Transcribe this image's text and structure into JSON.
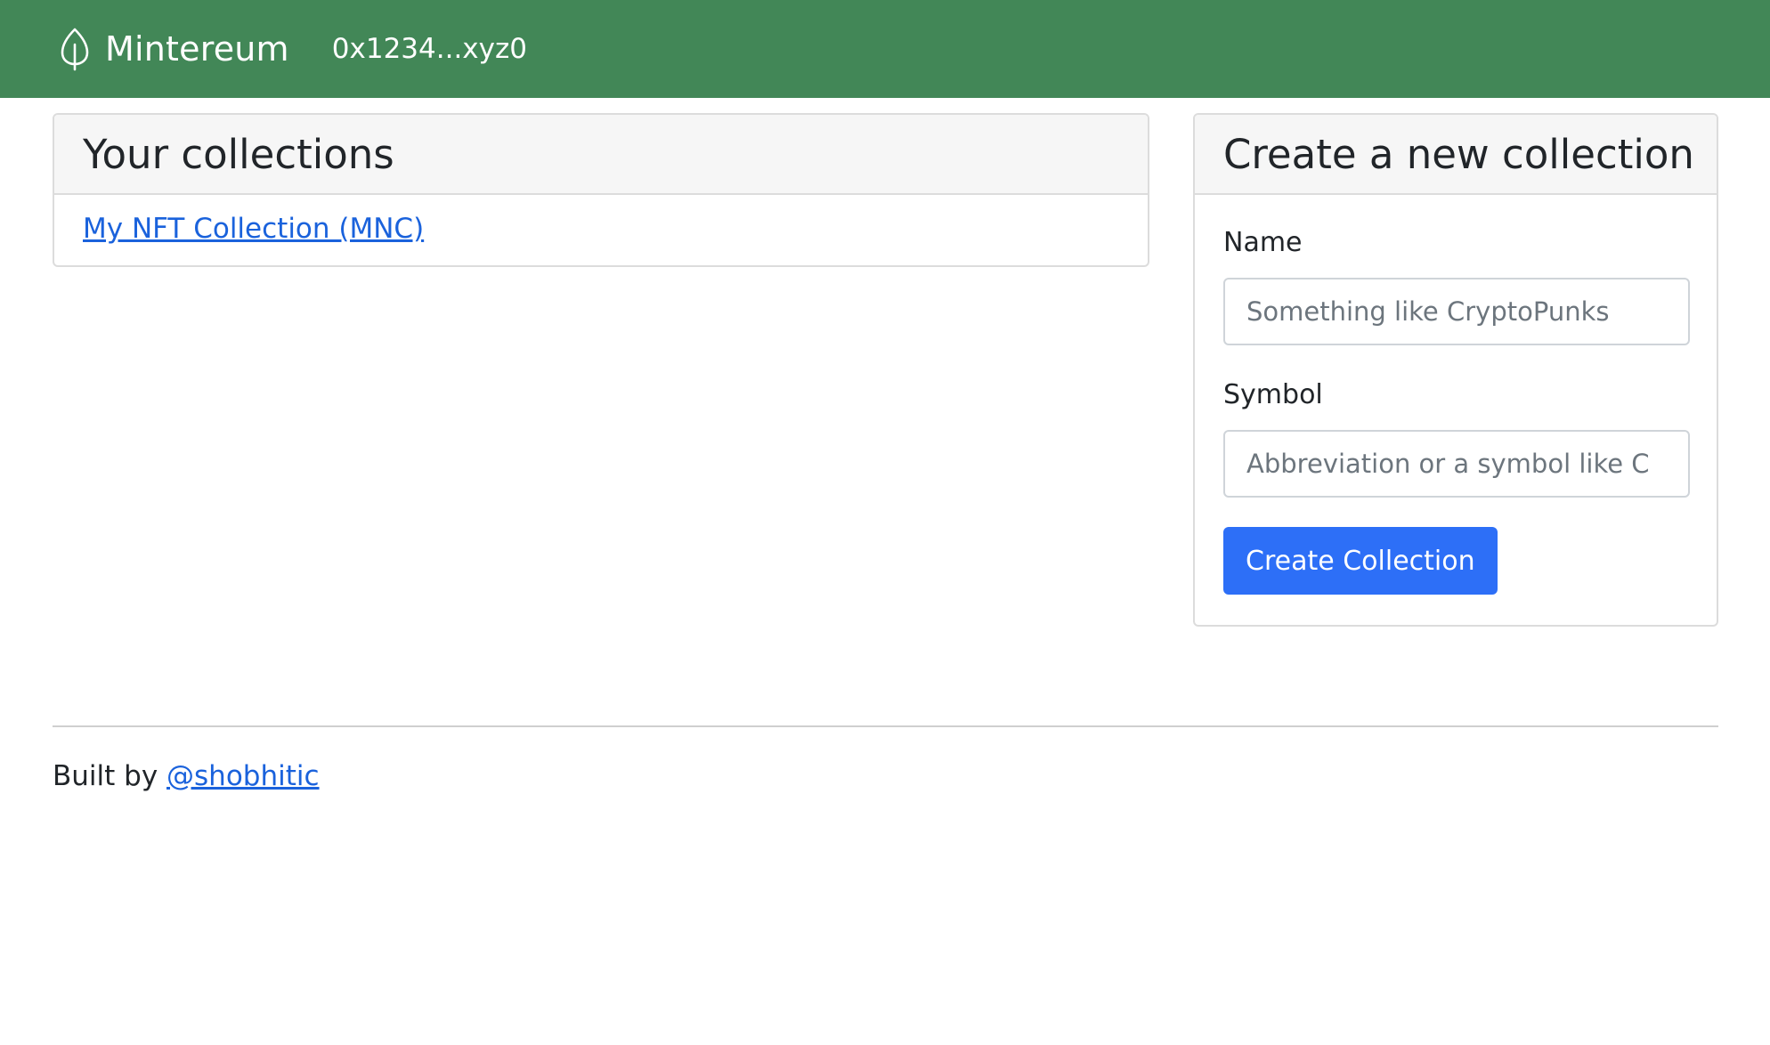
{
  "navbar": {
    "brand_icon": "leaf-icon",
    "brand_name": "Mintereum",
    "wallet_address": "0x1234...xyz0",
    "background_color": "#428757"
  },
  "collections_panel": {
    "title": "Your collections",
    "items": [
      {
        "label": "My NFT Collection (MNC)"
      }
    ]
  },
  "create_panel": {
    "title": "Create a new collection",
    "name_label": "Name",
    "name_placeholder": "Something like CryptoPunks",
    "name_value": "",
    "symbol_label": "Symbol",
    "symbol_placeholder": "Abbreviation or a symbol like C",
    "symbol_value": "",
    "submit_label": "Create Collection",
    "submit_color": "#2d6ff7"
  },
  "footer": {
    "prefix": "Built by",
    "author_link": "@shobhitic"
  }
}
